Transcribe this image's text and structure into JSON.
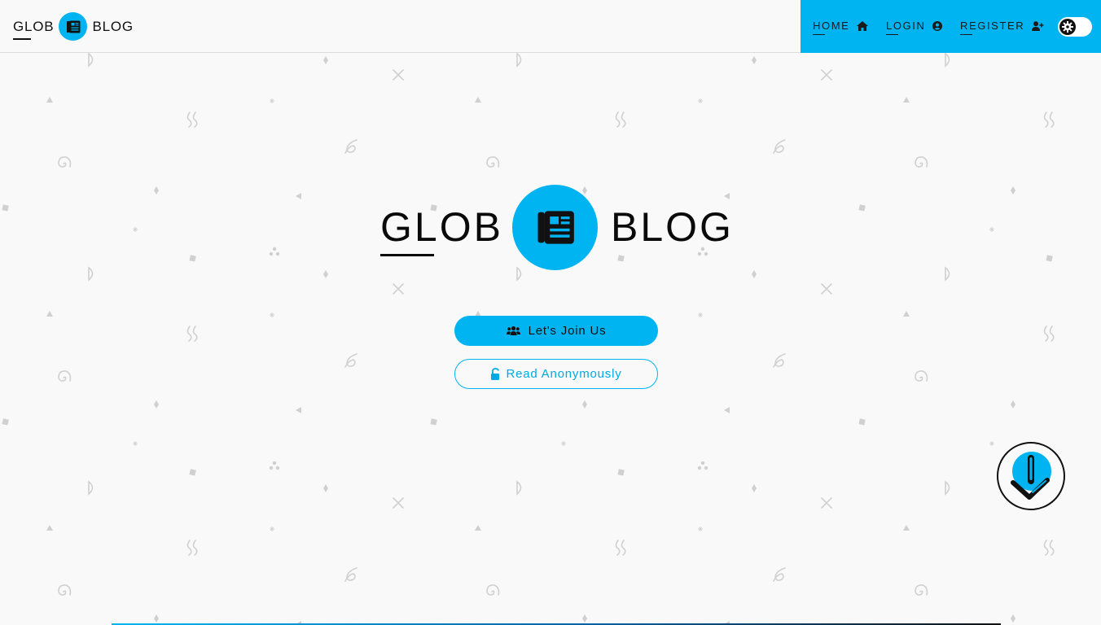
{
  "brand": {
    "word1": "GLOB",
    "word2": "BLOG",
    "icon": "newspaper-icon"
  },
  "nav": {
    "items": [
      {
        "label": "HOME",
        "icon": "home-icon"
      },
      {
        "label": "LOGIN",
        "icon": "user-circle-icon"
      },
      {
        "label": "REGISTER",
        "icon": "user-plus-icon"
      }
    ],
    "theme_toggle_icon": "gear-icon"
  },
  "hero": {
    "word1": "GLOB",
    "word2": "BLOG",
    "icon": "newspaper-icon",
    "join_label": "Let's Join Us",
    "join_icon": "users-icon",
    "anon_label": "Read Anonymously",
    "anon_icon": "lock-open-icon"
  },
  "scroll_button_icon": "arrow-down-icon",
  "colors": {
    "accent": "#00b4f1",
    "background": "#f9f9f9",
    "text": "#111111",
    "pattern": "#d0d0d0"
  }
}
